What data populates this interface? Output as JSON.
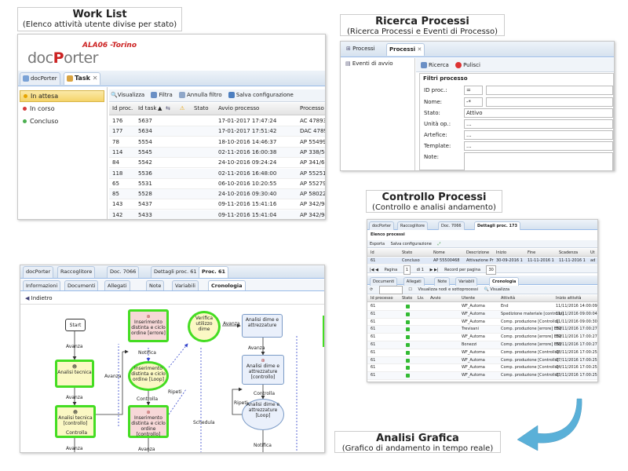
{
  "captions": {
    "work_list": {
      "title": "Work List",
      "subtitle": "(Elenco attività utente divise per stato)"
    },
    "ricerca": {
      "title": "Ricerca Processi",
      "subtitle": "(Ricerca Processi e Eventi di Processo)"
    },
    "controllo": {
      "title": "Controllo Processi",
      "subtitle": "(Controllo e analisi andamento)"
    },
    "analisi": {
      "title": "Analisi Grafica",
      "subtitle": "(Grafico di andamento in tempo reale)"
    }
  },
  "worklist": {
    "logo_tagline": "ALA06 -Torino",
    "logo_doc": "doc",
    "logo_p": "P",
    "logo_rest": "orter",
    "tabs": [
      "docPorter",
      "Task"
    ],
    "status_items": [
      "In attesa",
      "In corso",
      "Concluso"
    ],
    "toolbar": [
      "Visualizza",
      "Filtra",
      "Annulla filtro",
      "Salva configurazione"
    ],
    "columns": [
      "Id proc.",
      "Id task",
      "",
      "",
      "Stato",
      "Avvio processo",
      "Processo"
    ],
    "rows": [
      [
        "176",
        "5637",
        "17-01-2017 17:47:24",
        "AC 47893"
      ],
      [
        "177",
        "5634",
        "17-01-2017 17:51:42",
        "DAC 4789"
      ],
      [
        "78",
        "5554",
        "18-10-2016 14:46:37",
        "AP 55499"
      ],
      [
        "114",
        "5545",
        "02-11-2016 16:00:38",
        "AP 338/50"
      ],
      [
        "84",
        "5542",
        "24-10-2016 09:24:24",
        "AP 341/6"
      ],
      [
        "118",
        "5536",
        "02-11-2016 16:48:00",
        "AP 55251"
      ],
      [
        "65",
        "5531",
        "06-10-2016 10:20:55",
        "AP 55279"
      ],
      [
        "85",
        "5528",
        "24-10-2016 09:30:40",
        "AP 58022"
      ],
      [
        "143",
        "5437",
        "09-11-2016 15:41:16",
        "AP 342/94"
      ],
      [
        "142",
        "5433",
        "09-11-2016 15:41:04",
        "AP 342/94"
      ]
    ]
  },
  "ricerca": {
    "left_title": "Processi",
    "tab": "Processi",
    "left_item": "Eventi di avvio",
    "toolbar": [
      "Ricerca",
      "Pulisci"
    ],
    "filter_title": "Filtri processo",
    "fields": [
      {
        "label": "ID proc.:",
        "op": "=",
        "value": ""
      },
      {
        "label": "Nome:",
        "op": "-*",
        "value": ""
      },
      {
        "label": "Stato:",
        "op": "",
        "value": "Attivo"
      },
      {
        "label": "Unità op.:",
        "op": "",
        "value": "..."
      },
      {
        "label": "Artefice:",
        "op": "",
        "value": "..."
      },
      {
        "label": "Template:",
        "op": "",
        "value": "..."
      },
      {
        "label": "Note:",
        "op": "",
        "value": ""
      }
    ]
  },
  "controllo": {
    "tabs": [
      "docPorter",
      "Raccoglitore",
      "Doc. 7066",
      "Dettagli proc. 173"
    ],
    "section": "Elenco processi",
    "toolbar": [
      "Esporta",
      "Salva configurazione"
    ],
    "columns": [
      "Id",
      "Stato",
      "Nome",
      "Descrizione",
      "Inizio",
      "Fine",
      "Scadenza",
      "Ut"
    ],
    "row": [
      "61",
      "Concluso",
      "AP 55500468",
      "Attivazione Pr",
      "30-09-2016 1",
      "11-11-2016 1",
      "11-11-2016 1",
      "ad"
    ],
    "pager": [
      "Pagina",
      "1",
      "di 1",
      "Record per pagina",
      "30"
    ],
    "subtabs": [
      "Documenti",
      "Allegati",
      "Note",
      "Variabili",
      "Cronologia"
    ],
    "sub_toolbar": [
      "Visualizza nodi e sottoprocessi",
      "Visualizza"
    ],
    "sub_columns": [
      "Id processo",
      "Stato",
      "Liv.",
      "Avvio",
      "Utente",
      "Attività",
      "Inizio attività"
    ],
    "sub_rows": [
      [
        "61",
        "WF_Automa",
        "End",
        "11/11/2016 14:00:09"
      ],
      [
        "61",
        "WF_Automa",
        "Spedizione materiale [controllo]",
        "11/11/2016 09:00:04"
      ],
      [
        "61",
        "WF_Automa",
        "Comp. produzione [Controllo]",
        "11/11/2016 09:00:30"
      ],
      [
        "61",
        "Trevisani",
        "Comp. produzione [errore] E52",
        "09/11/2016 17:00:27"
      ],
      [
        "61",
        "WF_Automa",
        "Comp. produzione [errore] E52",
        "09/11/2016 17:00:27"
      ],
      [
        "61",
        "Bonezzi",
        "Comp. produzione [errore] E52",
        "08/11/2016 17:00:27"
      ],
      [
        "61",
        "WF_Automa",
        "Comp. produzione [Controllo]",
        "08/11/2016 17:00:25"
      ],
      [
        "61",
        "WF_Automa",
        "Comp. produzione [Controllo]",
        "07/11/2016 17:00:25"
      ],
      [
        "61",
        "WF_Automa",
        "Comp. produzione [Controllo]",
        "04/11/2016 17:00:25"
      ],
      [
        "61",
        "WF_Automa",
        "Comp. produzione [Controllo]",
        "03/11/2016 17:00:25"
      ]
    ]
  },
  "grafico": {
    "tabs": [
      "docPorter",
      "Raccoglitore",
      "Doc. 7066",
      "Dettagli proc. 61",
      "Proc. 61"
    ],
    "subtabs": [
      "Informazioni",
      "Documenti",
      "Allegati",
      "Note",
      "Variabili",
      "Cronologia"
    ],
    "back": "Indietro",
    "nodes": {
      "start": "Start",
      "analisi_tecnica": "Analisi tecnica",
      "analisi_tecnica_ctrl": "Analisi tecnica [controllo]",
      "ins_errore": "Inserimento distinta e ciclo ordine [errore]",
      "ins_loop": "Inserimento distinta e ciclo ordine [Loop]",
      "ins_ctrl": "Inserimento distinta e ciclo ordine [controllo]",
      "verifica": "Verifica utilizzo dime",
      "analisi_dime": "Analisi dime e attrezzature",
      "analisi_dime_ctrl": "Analisi dime e attrezzature [controllo]",
      "analisi_dime_loop": "Analisi dime e attrezzature [Loop]"
    },
    "labels": {
      "avanza1": "Avanza",
      "avanza2": "Avanza",
      "avanza3": "Avanza",
      "avanza4": "Avanza",
      "avanza5": "Avanza",
      "avanza6": "Avanza",
      "avanza7": "Avanza",
      "notifica1": "Notifica",
      "notifica2": "Notifica",
      "controlla1": "Controlla",
      "controlla2": "Controlla",
      "controlla3": "Controlla",
      "ripeti1": "Ripeti",
      "ripeti2": "Ripeti",
      "schedula": "Schedula"
    }
  },
  "colors": {
    "green": "#44dd22",
    "brand_red": "#cc2222",
    "arrow": "#5ab0d8"
  }
}
